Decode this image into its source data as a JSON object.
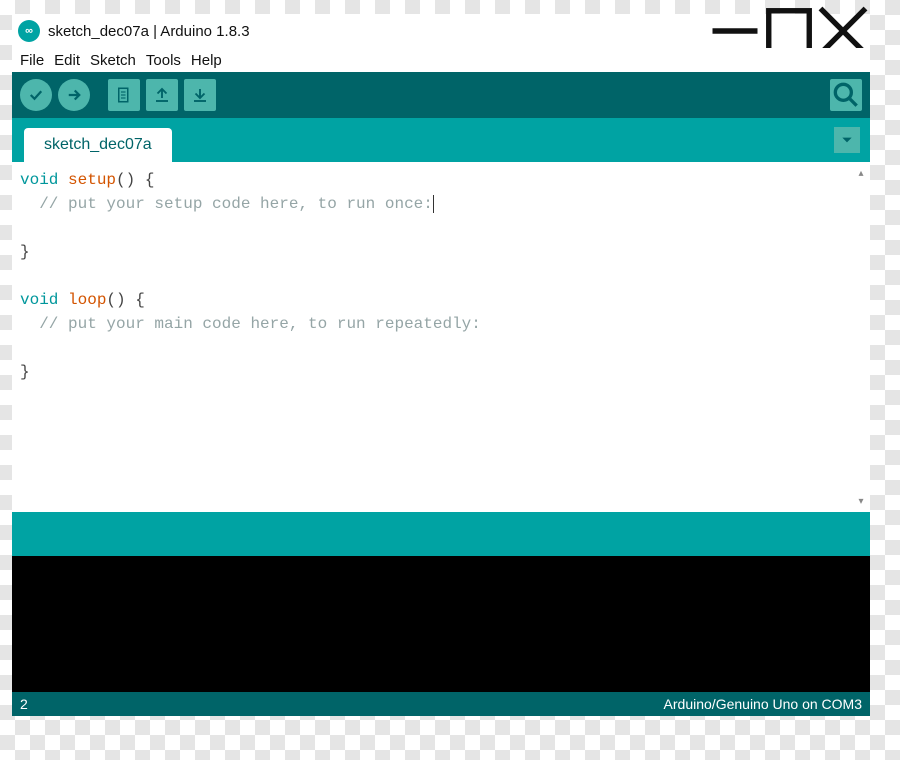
{
  "window": {
    "title": "sketch_dec07a | Arduino 1.8.3"
  },
  "menubar": {
    "file": "File",
    "edit": "Edit",
    "sketch": "Sketch",
    "tools": "Tools",
    "help": "Help"
  },
  "toolbar": {
    "verify": "Verify",
    "upload": "Upload",
    "new": "New",
    "open": "Open",
    "save": "Save",
    "serial_monitor": "Serial Monitor"
  },
  "tabs": {
    "active": "sketch_dec07a"
  },
  "code": {
    "kw_void1": "void",
    "fn_setup": "setup",
    "sig1": "() {",
    "comment_setup": "  // put your setup code here, to run once:",
    "brace1": "}",
    "kw_void2": "void",
    "fn_loop": "loop",
    "sig2": "() {",
    "comment_loop": "  // put your main code here, to run repeatedly:",
    "brace2": "}"
  },
  "status": {
    "line": "2",
    "board": "Arduino/Genuino Uno on COM3"
  }
}
